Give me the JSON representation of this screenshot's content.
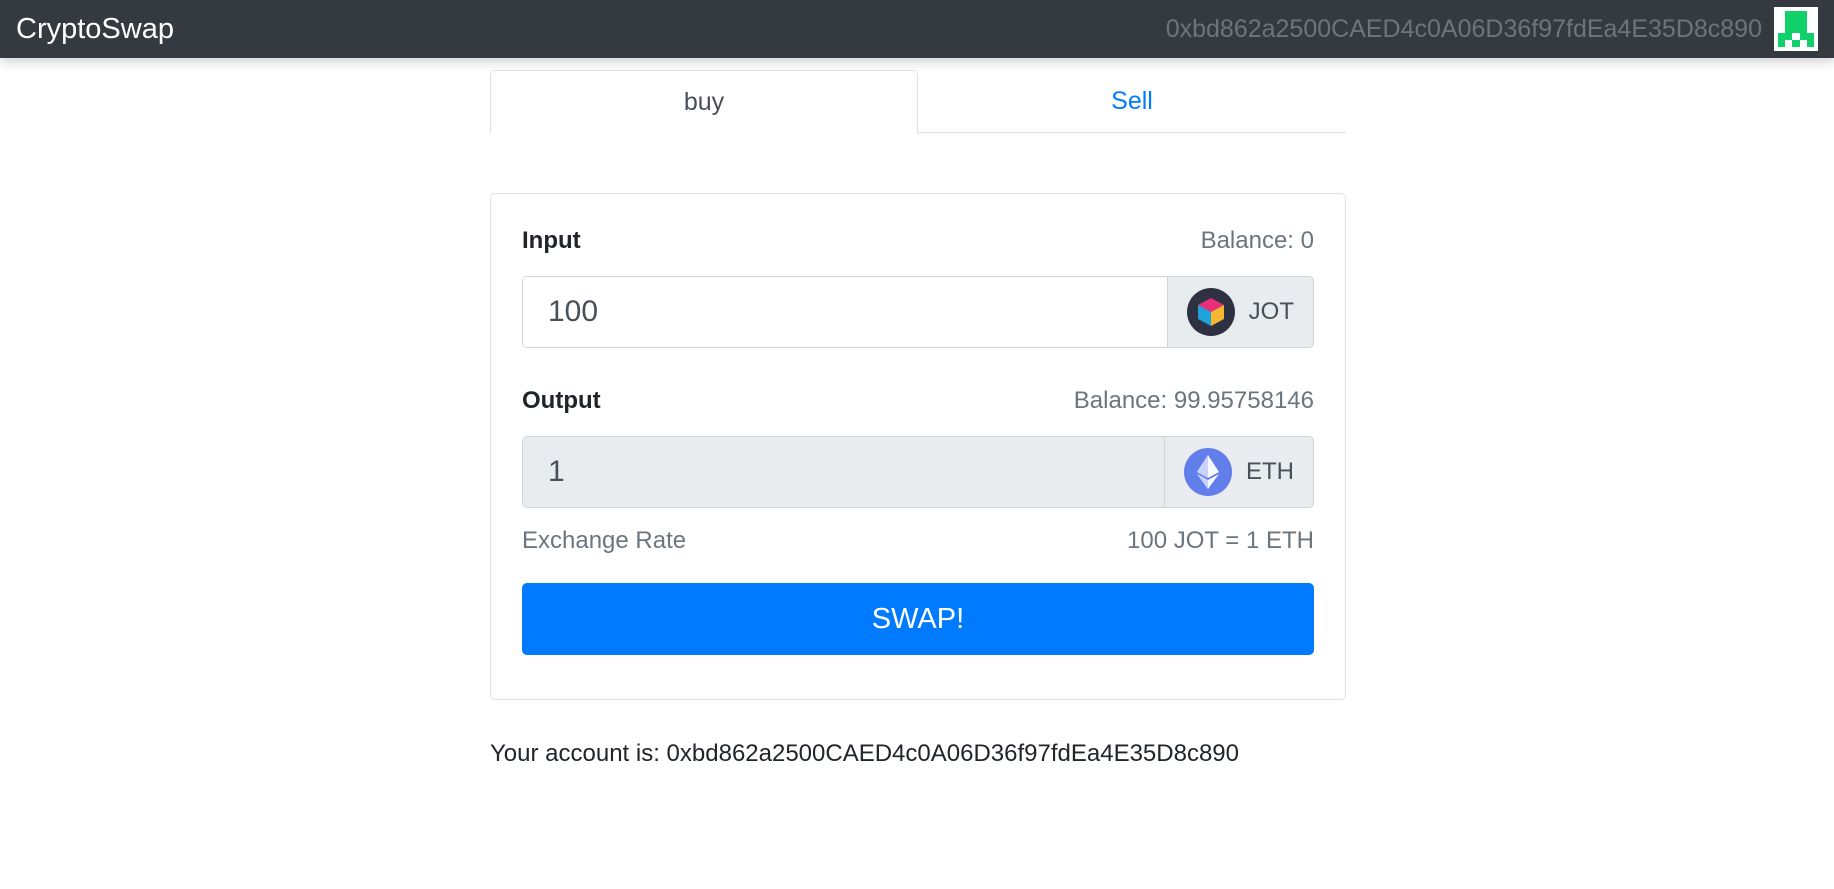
{
  "navbar": {
    "brand": "CryptoSwap",
    "address": "0xbd862a2500CAED4c0A06D36f97fdEa4E35D8c890",
    "avatar_icon": "identicon-icon"
  },
  "tabs": [
    {
      "label": "buy",
      "active": true
    },
    {
      "label": "Sell",
      "active": false
    }
  ],
  "swap": {
    "input": {
      "label": "Input",
      "balance": "Balance: 0",
      "value": "100",
      "token": "JOT",
      "token_icon": "jot-cube-icon"
    },
    "output": {
      "label": "Output",
      "balance": "Balance: 99.95758146",
      "value": "1",
      "token": "ETH",
      "token_icon": "ethereum-icon"
    },
    "exchange_rate_label": "Exchange Rate",
    "exchange_rate_value": "100 JOT = 1 ETH",
    "button_label": "SWAP!"
  },
  "account": {
    "text": "Your account is: 0xbd862a2500CAED4c0A06D36f97fdEa4E35D8c890"
  },
  "colors": {
    "navbar_bg": "#343a40",
    "primary": "#007bff",
    "muted": "#6c757d",
    "identicon_green": "#10d06a",
    "eth_blue": "#627eea"
  }
}
